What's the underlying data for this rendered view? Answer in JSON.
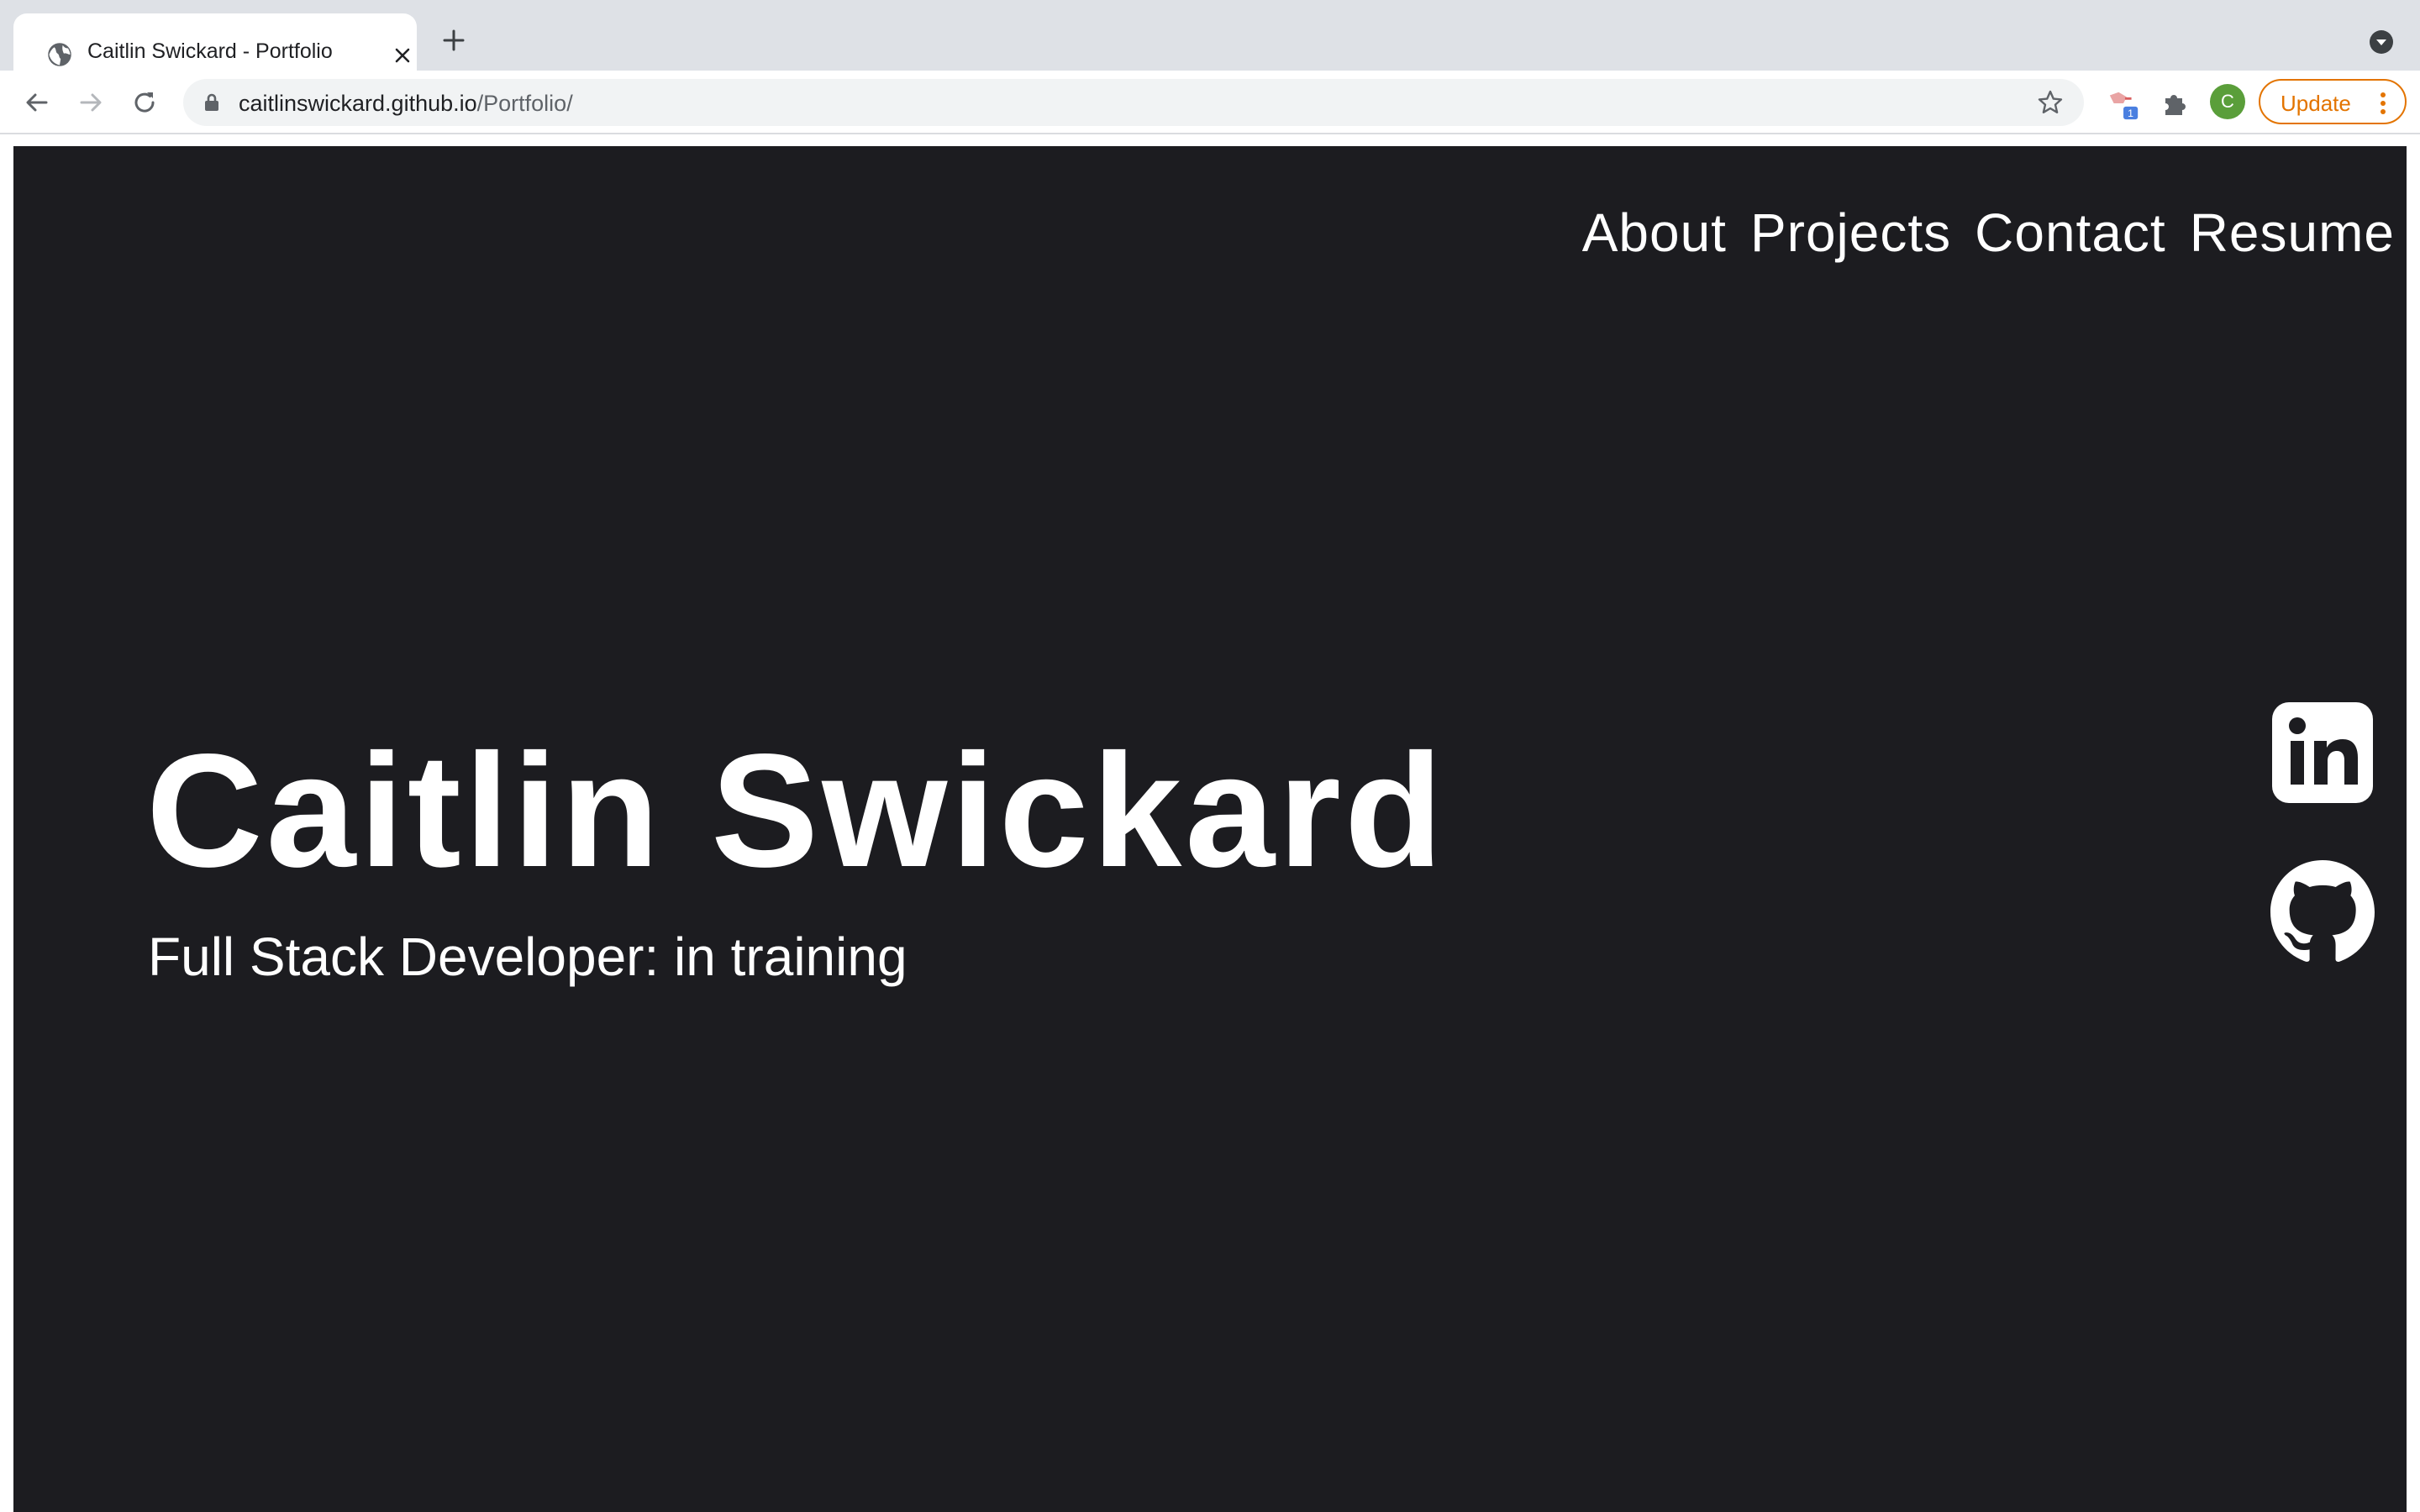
{
  "browser": {
    "tab": {
      "title": "Caitlin Swickard - Portfolio",
      "favicon": "globe-icon"
    },
    "new_tab_icon": "plus-icon",
    "tab_search_icon": "chevron-down-circle-icon",
    "url": {
      "host": "caitlinswickard.github.io",
      "path": "/Portfolio/"
    },
    "extensions_badge": "1",
    "profile_initial": "C",
    "update_label": "Update",
    "colors": {
      "tabstrip": "#dee1e6",
      "update_accent": "#e37400",
      "avatar": "#5a9e3a"
    }
  },
  "page": {
    "background": "#1c1c20",
    "nav": [
      "About",
      "Projects",
      "Contact",
      "Resume"
    ],
    "hero": {
      "name": "Caitlin Swickard",
      "subtitle": "Full Stack Developer: in training"
    },
    "social": [
      {
        "name": "LinkedIn",
        "icon": "linkedin-icon"
      },
      {
        "name": "GitHub",
        "icon": "github-icon"
      }
    ]
  }
}
